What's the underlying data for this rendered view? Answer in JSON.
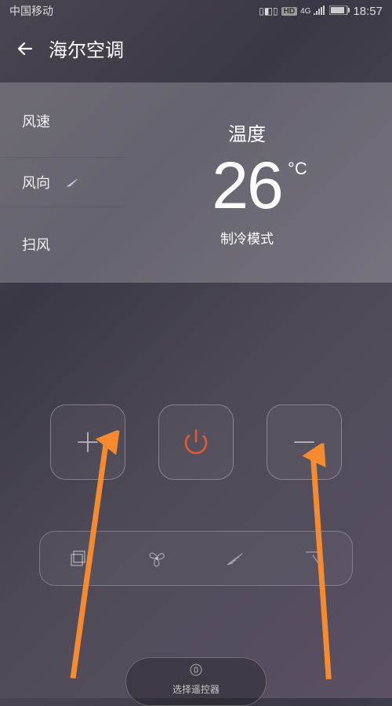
{
  "status": {
    "carrier": "中国移动",
    "network_badge": "HD",
    "network_gen": "4G",
    "time": "18:57"
  },
  "nav": {
    "title": "海尔空调"
  },
  "left_menu": {
    "wind_speed": "风速",
    "wind_direction": "风向",
    "sweep": "扫风"
  },
  "display": {
    "temp_label": "温度",
    "temp_value": "26",
    "temp_unit": "°C",
    "mode": "制冷模式"
  },
  "bottom": {
    "selector_label": "选择遥控器"
  }
}
